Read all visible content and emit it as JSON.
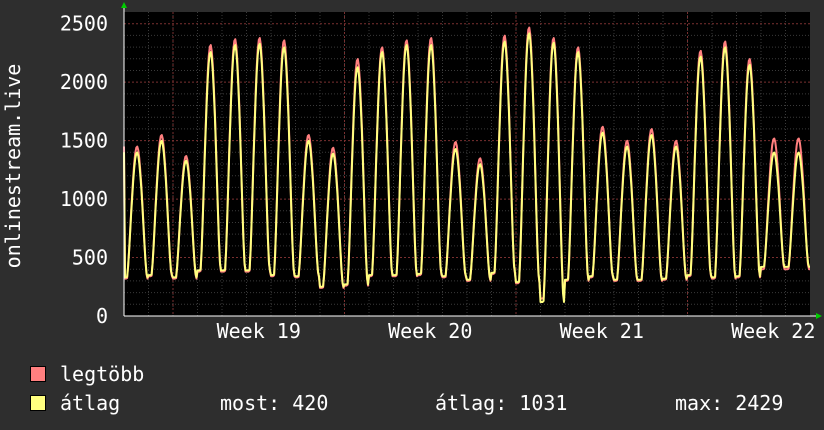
{
  "chart_data": {
    "type": "line",
    "ylabel": "onlinestream.live",
    "ylim": [
      0,
      2600
    ],
    "yticks": [
      0,
      500,
      1000,
      1500,
      2000,
      2500
    ],
    "xlim": [
      0,
      28
    ],
    "x_ticks": [
      {
        "label": "Week 19",
        "x": 5.5
      },
      {
        "label": "Week 20",
        "x": 12.5
      },
      {
        "label": "Week 21",
        "x": 19.5
      },
      {
        "label": "Week 22",
        "x": 26.5
      }
    ],
    "grid": true,
    "series": [
      {
        "name": "legtöbb",
        "color": "#ff7f7f",
        "peaks": [
          1450,
          1550,
          1370,
          2320,
          2370,
          2380,
          2360,
          1550,
          1440,
          2200,
          2300,
          2360,
          2380,
          1490,
          1350,
          2400,
          2470,
          2380,
          2300,
          1620,
          1500,
          1600,
          1500,
          2270,
          2350,
          2200,
          1520
        ],
        "troughs": [
          320,
          340,
          320,
          380,
          380,
          380,
          340,
          330,
          240,
          260,
          340,
          340,
          350,
          330,
          300,
          360,
          280,
          150,
          300,
          330,
          300,
          300,
          310,
          340,
          320,
          330,
          400
        ]
      },
      {
        "name": "átlag",
        "color": "#ffff7f",
        "peaks": [
          1400,
          1500,
          1330,
          2260,
          2320,
          2330,
          2300,
          1500,
          1390,
          2130,
          2260,
          2320,
          2320,
          1430,
          1300,
          2350,
          2420,
          2340,
          2260,
          1570,
          1450,
          1550,
          1450,
          2220,
          2300,
          2150,
          1400
        ],
        "troughs": [
          330,
          350,
          330,
          390,
          390,
          390,
          350,
          340,
          250,
          270,
          350,
          350,
          360,
          340,
          310,
          370,
          290,
          120,
          310,
          340,
          310,
          310,
          320,
          350,
          330,
          340,
          420
        ]
      }
    ],
    "stats": {
      "most": "420",
      "atlag": "1031",
      "max": "2429"
    }
  },
  "legend": {
    "item1": "legtöbb",
    "item2": "átlag"
  },
  "stats_text": {
    "most": "most: 420",
    "atlag": "átlag: 1031",
    "max": "max: 2429"
  }
}
